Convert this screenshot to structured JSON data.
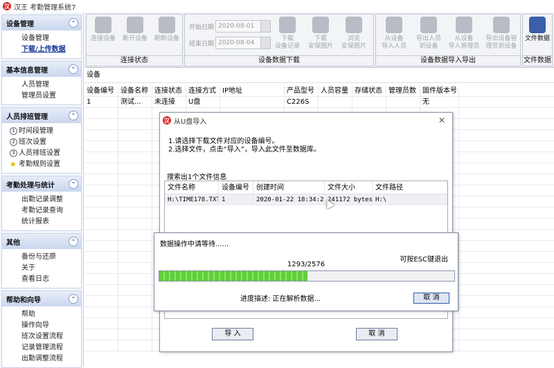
{
  "window": {
    "title": "汉王 考勤管理系统7",
    "logo": "汉"
  },
  "sidebar": [
    {
      "title": "设备管理",
      "items": [
        "设备管理",
        "下载/上传数据"
      ],
      "active": 1
    },
    {
      "title": "基本信息管理",
      "items": [
        "人员管理",
        "管理员设置"
      ]
    },
    {
      "title": "人员排班管理",
      "items": [
        "时间段管理",
        "班次设置",
        "人员排班设置",
        "考勤规则设置"
      ],
      "numbers": [
        "1",
        "2",
        "3"
      ]
    },
    {
      "title": "考勤处理与统计",
      "items": [
        "出勤记录调整",
        "考勤记录查询",
        "统计报表"
      ]
    },
    {
      "title": "其他",
      "items": [
        "备份与还原",
        "关于",
        "查看日志"
      ]
    },
    {
      "title": "帮助和向导",
      "items": [
        "帮助",
        "操作向导",
        "班次设置流程",
        "记录管理流程",
        "出勤调整流程"
      ]
    }
  ],
  "toolbar": {
    "conn": {
      "label": "连接状态",
      "buttons": [
        "连接设备",
        "断开设备",
        "刷新设备"
      ]
    },
    "download": {
      "label": "设备数据下载",
      "start_label": "开始日期",
      "start_value": "2020-08-01",
      "end_label": "结束日期",
      "end_value": "2020-08-04",
      "buttons": [
        "下载\n设备记录",
        "下载\n安保图片",
        "浏览\n安保图片"
      ]
    },
    "impexp": {
      "label": "设备数据导入导出",
      "buttons": [
        "从设备\n导入人员",
        "导出人员\n到设备",
        "从设备\n导入管理员",
        "导出设备管\n理员到设备"
      ]
    },
    "file": {
      "label": "文件数据",
      "buttons": [
        "文件数据"
      ]
    }
  },
  "main": {
    "title": "设备",
    "columns": [
      "设备编号",
      "设备名称",
      "连接状态",
      "连接方式",
      "IP地址",
      "产品型号",
      "人员容量",
      "存储状态",
      "管理员数",
      "固件版本号"
    ],
    "rows": [
      [
        "1",
        "测试...",
        "未连接",
        "U盘",
        "",
        "C226S",
        "",
        "",
        "",
        "无"
      ]
    ]
  },
  "dialog": {
    "title": "从U盘导入",
    "close": "✕",
    "instr1": "1.请选择下载文件对应的设备编号。",
    "instr2": "2.选择文件，点击“导入”，导入此文件至数据库。",
    "found": "搜索出1个文件信息",
    "columns": [
      "文件名称",
      "设备编号",
      "创建时间",
      "文件大小",
      "文件路径"
    ],
    "rows": [
      [
        "H:\\TIME178.TXT",
        "1",
        "2020-01-22 18:34:25",
        "241172 bytes",
        "H:\\"
      ]
    ],
    "import_btn": "导 入",
    "cancel_btn": "取 消"
  },
  "progress": {
    "text": "数据操作中请等待......",
    "esc": "可按ESC键退出",
    "count": "1293/2576",
    "fraction": 0.502,
    "desc": "进度描述: 正在解析数据...",
    "cancel": "取 消"
  }
}
